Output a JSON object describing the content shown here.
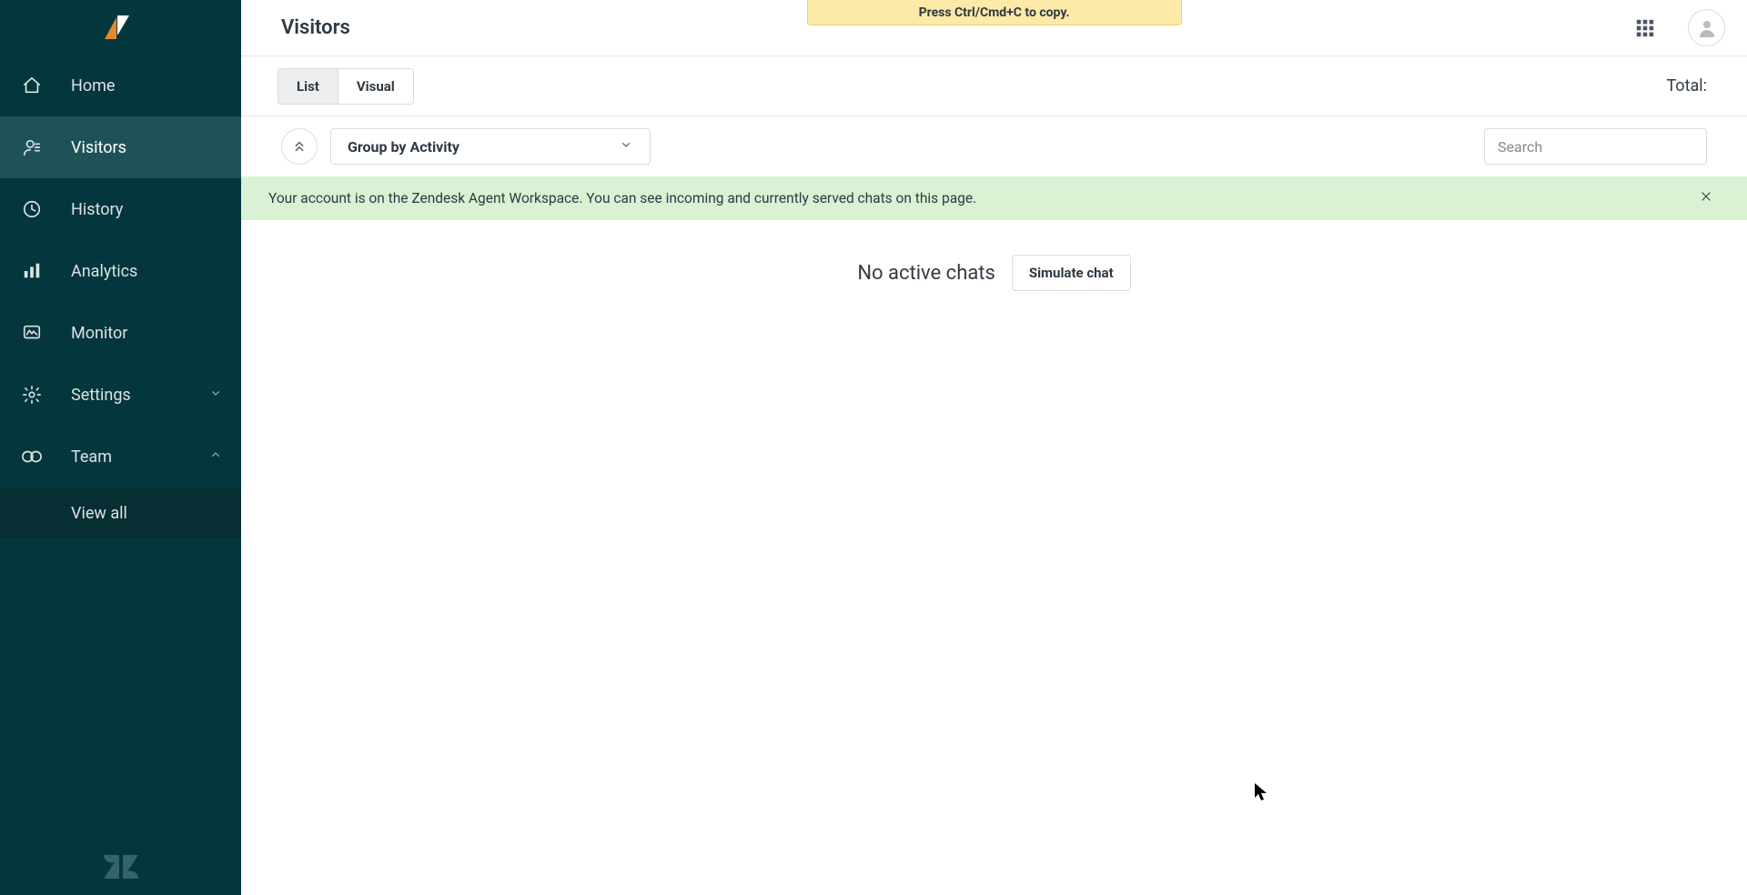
{
  "sidebar": {
    "items": [
      {
        "label": "Home",
        "icon": "home-icon"
      },
      {
        "label": "Visitors",
        "icon": "visitors-icon",
        "active": true
      },
      {
        "label": "History",
        "icon": "history-icon"
      },
      {
        "label": "Analytics",
        "icon": "analytics-icon"
      },
      {
        "label": "Monitor",
        "icon": "monitor-icon"
      },
      {
        "label": "Settings",
        "icon": "settings-icon",
        "expandable": true,
        "expanded": false
      },
      {
        "label": "Team",
        "icon": "team-icon",
        "expandable": true,
        "expanded": true
      }
    ],
    "team_subitems": [
      {
        "label": "View all"
      }
    ]
  },
  "header": {
    "page_title": "Visitors",
    "copy_banner": "Press Ctrl/Cmd+C to copy."
  },
  "tabs": {
    "list_label": "List",
    "visual_label": "Visual",
    "active": "List",
    "total_label": "Total:"
  },
  "group_row": {
    "selected_label": "Group by Activity"
  },
  "search": {
    "placeholder": "Search",
    "value": ""
  },
  "info_banner": {
    "text": "Your account is on the Zendesk Agent Workspace. You can see incoming and currently served chats on this page."
  },
  "empty_state": {
    "message": "No active chats",
    "simulate_label": "Simulate chat"
  }
}
